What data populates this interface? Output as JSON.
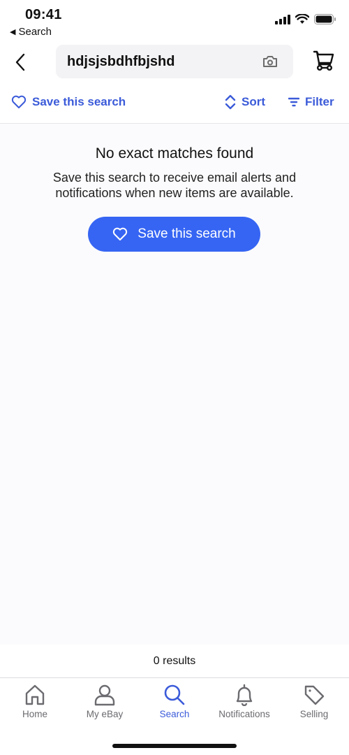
{
  "status_bar": {
    "time": "09:41",
    "back_app_label": "Search",
    "icons": [
      "cellular-signal-icon",
      "wifi-icon",
      "battery-icon"
    ]
  },
  "header": {
    "search_query": "hdjsjsbdhfbjshd",
    "icons": [
      "back-chevron-icon",
      "camera-icon",
      "cart-icon"
    ]
  },
  "actions": {
    "save_search_label": "Save this search",
    "sort_label": "Sort",
    "filter_label": "Filter"
  },
  "empty_state": {
    "title": "No exact matches found",
    "description_line1": "Save this search to receive email alerts and",
    "description_line2": "notifications when new items are available.",
    "button_label": "Save this search"
  },
  "results": {
    "count_label": "0 results"
  },
  "tabbar": {
    "items": [
      {
        "label": "Home",
        "icon": "home-icon",
        "active": false
      },
      {
        "label": "My eBay",
        "icon": "person-icon",
        "active": false
      },
      {
        "label": "Search",
        "icon": "search-icon",
        "active": true
      },
      {
        "label": "Notifications",
        "icon": "bell-icon",
        "active": false
      },
      {
        "label": "Selling",
        "icon": "tag-icon",
        "active": false
      }
    ]
  },
  "colors": {
    "accent": "#3b5bd9",
    "button_bg": "#3665f3",
    "inactive_tab": "#6b6b70"
  }
}
